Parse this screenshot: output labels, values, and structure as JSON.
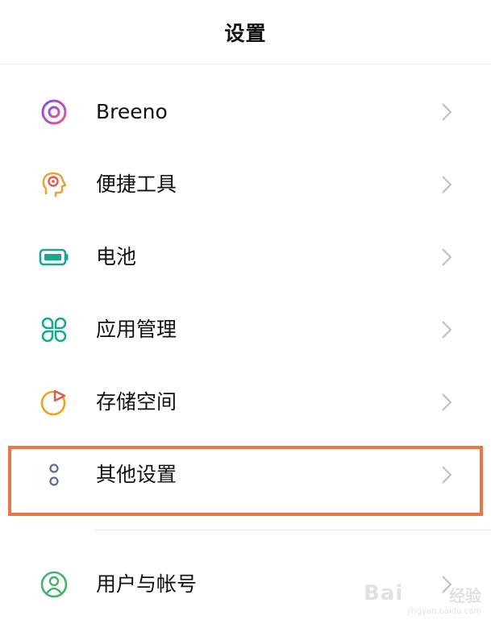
{
  "header": {
    "title": "设置"
  },
  "items": [
    {
      "label": "Breeno",
      "icon": "breeno-icon",
      "color": "#b24fd1"
    },
    {
      "label": "便捷工具",
      "icon": "convenience-tools-icon",
      "color": "#e8a43a"
    },
    {
      "label": "电池",
      "icon": "battery-icon",
      "color": "#18a88f"
    },
    {
      "label": "应用管理",
      "icon": "app-management-icon",
      "color": "#18a88f"
    },
    {
      "label": "存储空间",
      "icon": "storage-icon",
      "color": "#f0a21c"
    },
    {
      "label": "其他设置",
      "icon": "other-settings-icon",
      "color": "#5b6a9c"
    },
    {
      "label": "用户与帐号",
      "icon": "user-account-icon",
      "color": "#45b46a"
    }
  ],
  "highlight_color": "#ec7547",
  "watermark": {
    "logo": "Bai",
    "text": "经验",
    "url": "jingyan.baidu.com"
  }
}
